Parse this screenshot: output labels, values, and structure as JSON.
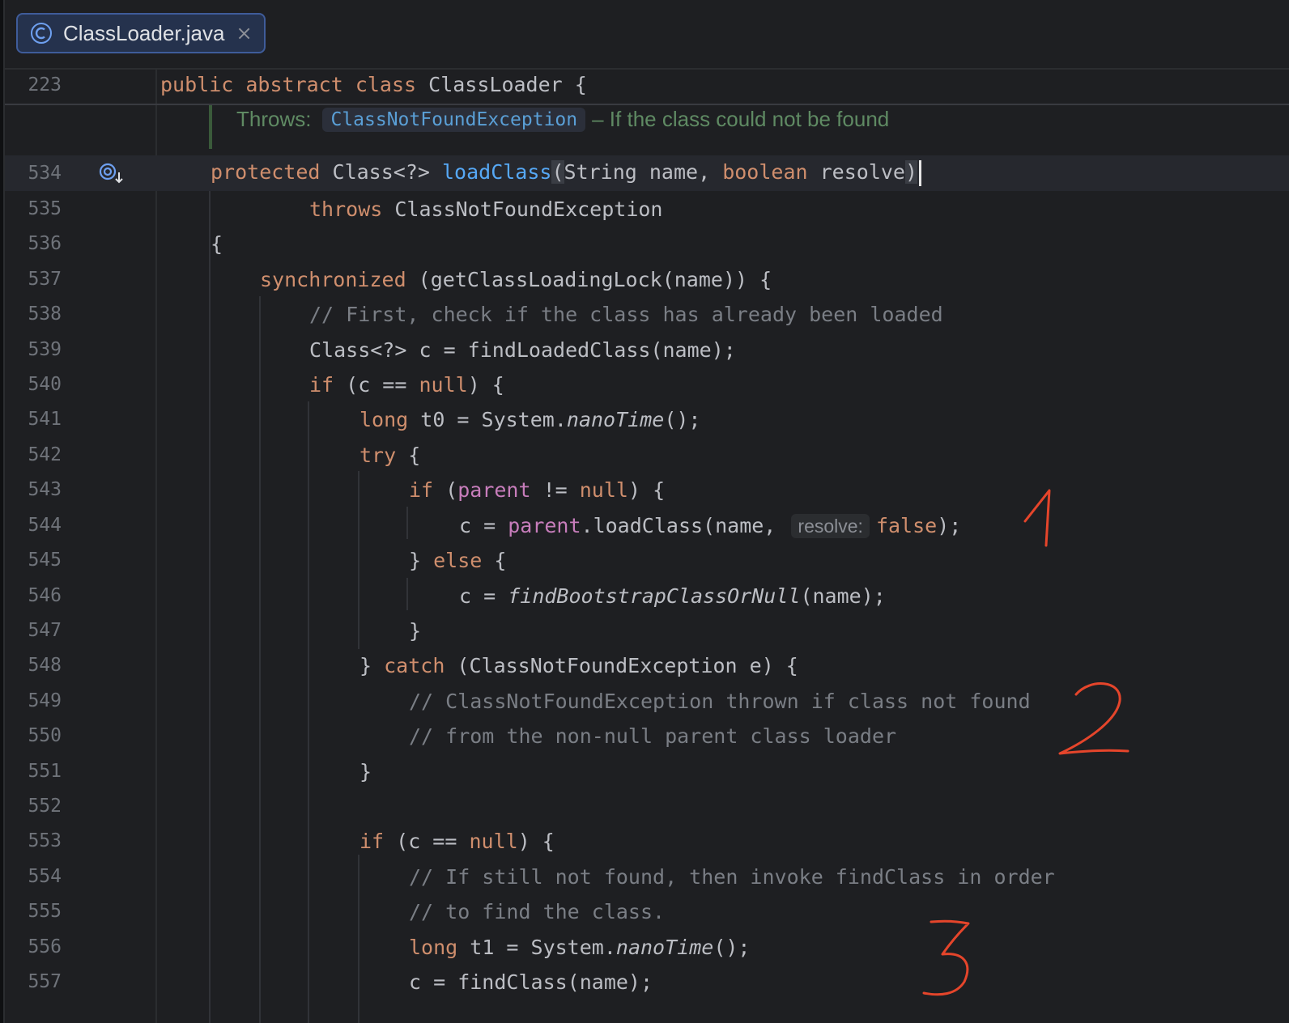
{
  "tab": {
    "label": "ClassLoader.java",
    "close": "×"
  },
  "sticky": {
    "line": "223",
    "code": [
      [
        "kw",
        "public abstract class "
      ],
      [
        "t",
        "ClassLoader {"
      ]
    ]
  },
  "doc": {
    "prefix": "Throws:",
    "exception": "ClassNotFoundException",
    "text": "– If the class could not be found"
  },
  "lines": [
    {
      "n": "534"
    },
    {
      "n": "535"
    },
    {
      "n": "536"
    },
    {
      "n": "537"
    },
    {
      "n": "538"
    },
    {
      "n": "539"
    },
    {
      "n": "540"
    },
    {
      "n": "541"
    },
    {
      "n": "542"
    },
    {
      "n": "543"
    },
    {
      "n": "544"
    },
    {
      "n": "545"
    },
    {
      "n": "546"
    },
    {
      "n": "547"
    },
    {
      "n": "548"
    },
    {
      "n": "549"
    },
    {
      "n": "550"
    },
    {
      "n": "551"
    },
    {
      "n": "552"
    },
    {
      "n": "553"
    },
    {
      "n": "554"
    },
    {
      "n": "555"
    },
    {
      "n": "556"
    },
    {
      "n": "557"
    }
  ],
  "code": {
    "l534_kw": "protected ",
    "l534_a": "Class<?> ",
    "l534_fn": "loadClass",
    "l534_open": "(",
    "l534_b": "String name, ",
    "l534_kw2": "boolean ",
    "l534_c": "resolve",
    "l534_close": ")",
    "l535_kw": "throws ",
    "l535_a": "ClassNotFoundException",
    "l536": "{",
    "l537_kw": "synchronized ",
    "l537_a": "(getClassLoadingLock(name)) {",
    "l538": "// First, check if the class has already been loaded",
    "l539": "Class<?> c = findLoadedClass(name);",
    "l540_kw": "if ",
    "l540_a": "(c == ",
    "l540_kw2": "null",
    "l540_b": ") {",
    "l541_kw": "long ",
    "l541_a": "t0 = System.",
    "l541_it": "nanoTime",
    "l541_b": "();",
    "l542_kw": "try ",
    "l542_a": "{",
    "l543_kw": "if ",
    "l543_a": "(",
    "l543_field": "parent",
    "l543_b": " != ",
    "l543_kw2": "null",
    "l543_c": ") {",
    "l544_a": "c = ",
    "l544_field": "parent",
    "l544_b": ".loadClass(name, ",
    "l544_hint": "resolve:",
    "l544_kw": "false",
    "l544_c": ");",
    "l545_a": "} ",
    "l545_kw": "else ",
    "l545_b": "{",
    "l546_a": "c = ",
    "l546_it": "findBootstrapClassOrNull",
    "l546_b": "(name);",
    "l547": "}",
    "l548_a": "} ",
    "l548_kw": "catch ",
    "l548_b": "(ClassNotFoundException e) {",
    "l549": "// ClassNotFoundException thrown if class not found",
    "l550": "// from the non-null parent class loader",
    "l551": "}",
    "l553_kw": "if ",
    "l553_a": "(c == ",
    "l553_kw2": "null",
    "l553_b": ") {",
    "l554": "// If still not found, then invoke findClass in order",
    "l555": "// to find the class.",
    "l556_kw": "long ",
    "l556_a": "t1 = System.",
    "l556_it": "nanoTime",
    "l556_b": "();",
    "l557": "c = findClass(name);"
  },
  "annotations": [
    "1",
    "2",
    "3"
  ],
  "colors": {
    "keyword": "#cf8e6d",
    "function": "#56a8f5",
    "field": "#c77dbb",
    "comment": "#7a7e85",
    "annotation": "#e5452b"
  }
}
